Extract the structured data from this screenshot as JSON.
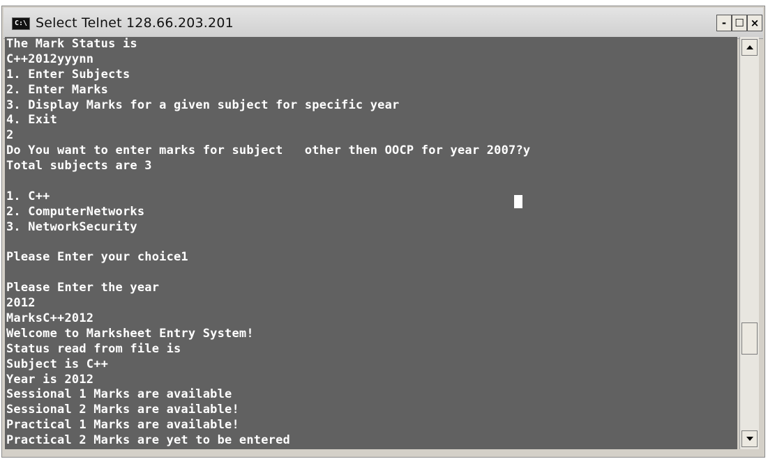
{
  "window": {
    "icon_label": "C:\\",
    "title": "Select Telnet 128.66.203.201",
    "minimize_label": "-",
    "maximize_label": "☐",
    "close_label": "×"
  },
  "console": {
    "lines": [
      "The Mark Status is",
      "C++2012yyynn",
      "1. Enter Subjects",
      "2. Enter Marks",
      "3. Display Marks for a given subject for specific year",
      "4. Exit",
      "2",
      "Do You want to enter marks for subject   other then OOCP for year 2007?y",
      "Total subjects are 3",
      "",
      "1. C++",
      "2. ComputerNetworks",
      "3. NetworkSecurity",
      "",
      "Please Enter your choice1",
      "",
      "Please Enter the year",
      "2012",
      "MarksC++2012",
      "Welcome to Marksheet Entry System!",
      "Status read from file is",
      "Subject is C++",
      "Year is 2012",
      "Sessional 1 Marks are available",
      "Sessional 2 Marks are available!",
      "Practical 1 Marks are available!",
      "Practical 2 Marks are yet to be entered"
    ]
  },
  "colors": {
    "console_background": "#616161",
    "console_text": "#ffffff",
    "window_chrome": "#d4d0c8"
  },
  "icons": {
    "app": "console-icon",
    "scroll_up": "arrow-up-icon",
    "scroll_down": "arrow-down-icon"
  }
}
